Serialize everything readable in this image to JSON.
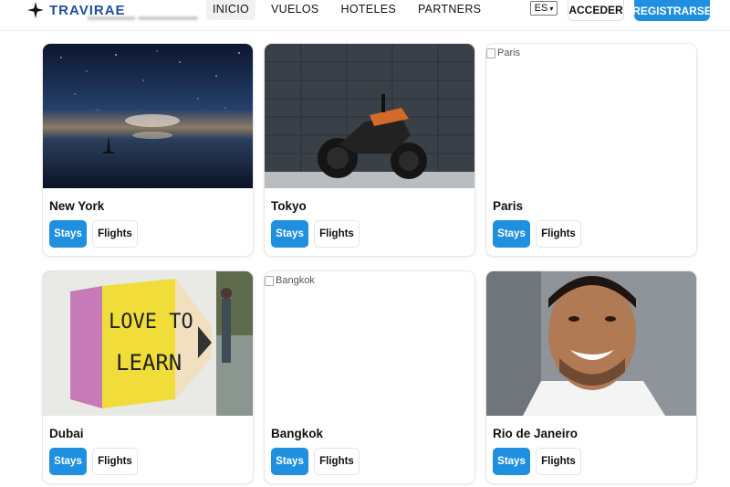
{
  "header": {
    "brand": "TRAVIRAE",
    "nav": [
      {
        "label": "INICIO",
        "active": true
      },
      {
        "label": "VUELOS",
        "active": false
      },
      {
        "label": "HOTELES",
        "active": false
      },
      {
        "label": "PARTNERS",
        "active": false
      }
    ],
    "language": "ES",
    "login_label": "ACCEDER",
    "register_label": "REGISTRARSE"
  },
  "destinations": [
    {
      "city": "New York",
      "image_alt": "",
      "image": "night-sky-lake",
      "stays_label": "Stays",
      "flights_label": "Flights"
    },
    {
      "city": "Tokyo",
      "image_alt": "",
      "image": "motorcycle-wall",
      "stays_label": "Stays",
      "flights_label": "Flights"
    },
    {
      "city": "Paris",
      "image_alt": "Paris",
      "image": "broken",
      "stays_label": "Stays",
      "flights_label": "Flights"
    },
    {
      "city": "Dubai",
      "image_alt": "",
      "image": "love-to-learn-pencil",
      "stays_label": "Stays",
      "flights_label": "Flights"
    },
    {
      "city": "Bangkok",
      "image_alt": "Bangkok",
      "image": "broken",
      "stays_label": "Stays",
      "flights_label": "Flights"
    },
    {
      "city": "Rio de Janeiro",
      "image_alt": "",
      "image": "smiling-man-portrait",
      "stays_label": "Stays",
      "flights_label": "Flights"
    }
  ],
  "colors": {
    "accent": "#1f8fe0",
    "brand": "#1f4e9a"
  }
}
